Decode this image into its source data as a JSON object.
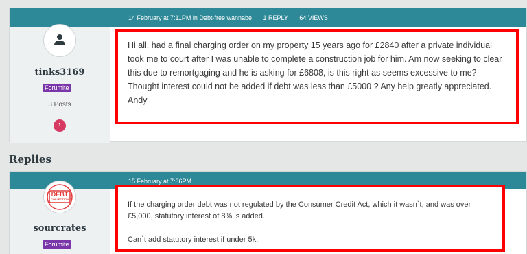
{
  "colors": {
    "accent": "#2d8897",
    "highlight": "#ff0000",
    "role_badge": "#7a36a8",
    "count_badge": "#d63a63"
  },
  "post": {
    "date": "14 February at 7:11PM",
    "category_prefix": "in",
    "category": "Debt-free wannabe",
    "replies": "1 REPLY",
    "views": "64 VIEWS",
    "author": {
      "name": "tinks3169",
      "role": "Forumite",
      "posts": "3 Posts",
      "badge": "1",
      "avatar_icon": "user-silhouette-icon"
    },
    "paragraphs": [
      "Hi all, had a final charging order on my property 15 years ago for £2840 after a private individual took me to court after I was unable to complete a construction job for him. Am now seeking to clear this due to remortgaging and he is asking for £6808, is this right as seems excessive to me? Thought interest could not be added if debt was less than £5000 ? Any help greatly appreciated. Andy"
    ]
  },
  "replies_heading": "Replies",
  "reply": {
    "date": "15 February at 7:36PM",
    "author": {
      "name": "sourcrates",
      "role": "Forumite",
      "avatar_text_top": "DEBT",
      "avatar_text_bottom": "COLLECTION"
    },
    "paragraphs": [
      "If the charging order debt was not regulated by the Consumer Credit Act, which it wasn`t, and was over £5,000, statutory interest of 8% is added.",
      "Can`t add statutory interest if under 5k."
    ]
  }
}
